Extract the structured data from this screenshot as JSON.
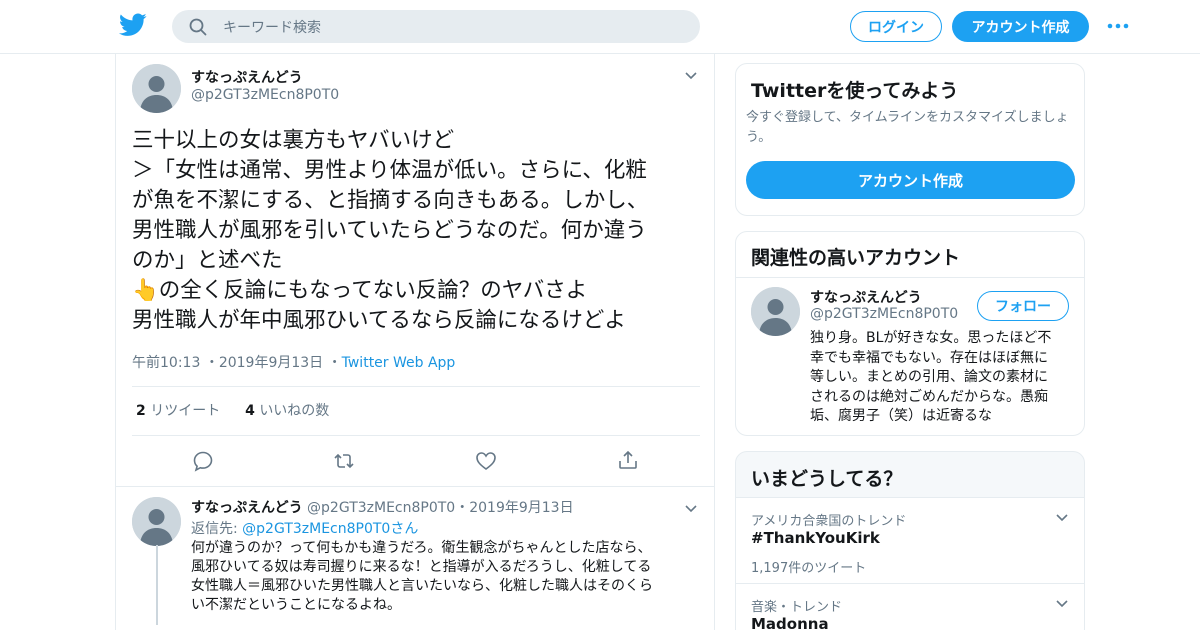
{
  "header": {
    "search_placeholder": "キーワード検索",
    "login_label": "ログイン",
    "signup_label": "アカウント作成",
    "brand_color": "#1da1f2"
  },
  "tweet": {
    "author_name": "すなっぷえんどう",
    "author_handle": "@p2GT3zMEcn8P0T0",
    "text_lines": [
      "三十以上の女は裏方もヤバいけど",
      "＞「女性は通常、男性より体温が低い。さらに、化粧",
      "が魚を不潔にする、と指摘する向きもある。しかし、",
      "男性職人が風邪を引いていたらどうなのだ。何か違う",
      "のか」と述べた",
      "👆の全く反論にもなってない反論？のヤバさよ",
      "男性職人が年中風邪ひいてるなら反論になるけどよ"
    ],
    "time": "午前10:13",
    "date": "2019年9月13日",
    "source": "Twitter Web App",
    "retweet_count": "2",
    "retweet_label": "リツイート",
    "like_count": "4",
    "like_label": "いいねの数"
  },
  "reply": {
    "author_name": "すなっぷえんどう",
    "author_handle": "@p2GT3zMEcn8P0T0",
    "date": "2019年9月13日",
    "reply_prefix": "返信先:",
    "reply_to_handle": "@p2GT3zMEcn8P0T0",
    "reply_suffix": "さん",
    "text_lines": [
      "何が違うのか？って何もかも違うだろ。衛生観念がちゃんとした店なら、",
      "風邪ひいてる奴は寿司握りに来るな！と指導が入るだろうし、化粧してる",
      "女性職人＝風邪ひいた男性職人と言いたいなら、化粧した職人はそのくら",
      "い不潔だということになるよね。"
    ]
  },
  "sidebar": {
    "try_card": {
      "title": "Twitterを使ってみよう",
      "subtitle_lines": [
        "今すぐ登録して、タイムラインをカスタマイズしましょ",
        "う。"
      ],
      "button_label": "アカウント作成"
    },
    "related_card": {
      "title": "関連性の高いアカウント",
      "account_name": "すなっぷえんどう",
      "account_handle": "@p2GT3zMEcn8P0T0",
      "follow_label": "フォロー",
      "bio_lines": [
        "独り身。BLが好きな女。思ったほど不",
        "幸でも幸福でもない。存在はほぼ無に",
        "等しい。まとめの引用、論文の素材に",
        "されるのは絶対ごめんだからな。愚痴",
        "垢、腐男子（笑）は近寄るな"
      ]
    },
    "trends_card": {
      "title": "いまどうしてる？",
      "trends": [
        {
          "category": "アメリカ合衆国のトレンド",
          "name": "#ThankYouKirk",
          "count": "1,197件のツイート"
        },
        {
          "category": "音楽・トレンド",
          "name": "Madonna"
        }
      ]
    }
  }
}
